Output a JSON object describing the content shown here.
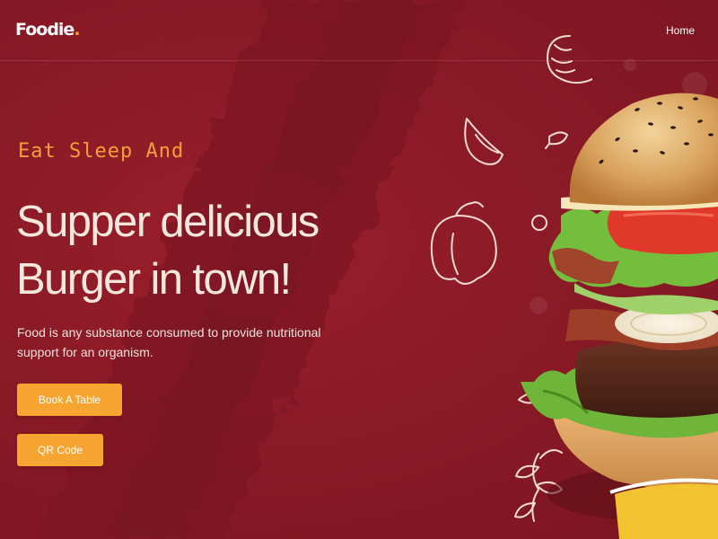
{
  "header": {
    "logo_text": "Foodie",
    "logo_dot": ".",
    "nav": {
      "home_label": "Home"
    }
  },
  "hero": {
    "tagline": "Eat Sleep And",
    "headline_line1": "Supper delicious",
    "headline_line2": "Burger in town!",
    "description": "Food is any substance consumed to provide nutritional support for an organism.",
    "book_button_label": "Book A Table",
    "qr_button_label": "QR Code"
  },
  "colors": {
    "background": "#8a1a26",
    "accent": "#f6a531",
    "tagline": "#f3a03a",
    "headline": "#f6e7dd"
  },
  "icons": [
    "shrimp-doodle-icon",
    "garlic-doodle-icon",
    "leaf-doodle-icon",
    "pepper-doodle-icon",
    "ring-doodle-icon",
    "parsley-doodle-icon"
  ]
}
